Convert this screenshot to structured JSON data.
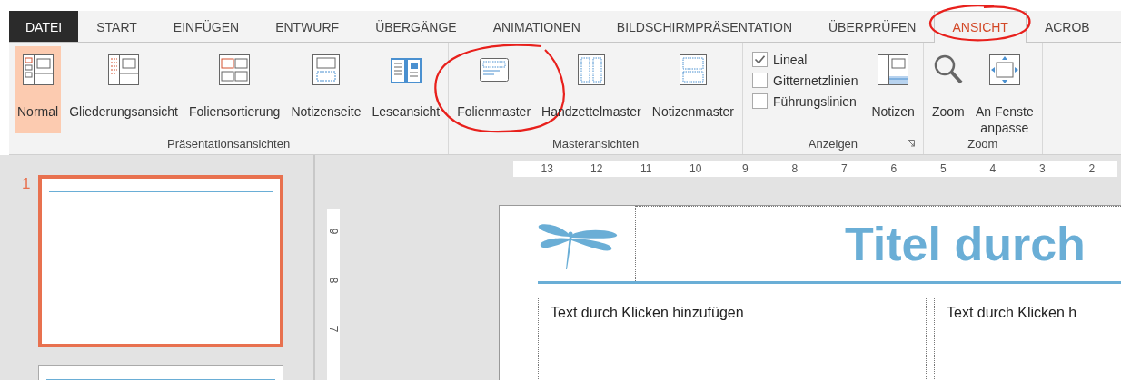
{
  "tabs": [
    {
      "label": "DATEI",
      "kind": "file",
      "selected": false,
      "circled": false
    },
    {
      "label": "START",
      "kind": "tab",
      "selected": false,
      "circled": false
    },
    {
      "label": "EINFÜGEN",
      "kind": "tab",
      "selected": false,
      "circled": false
    },
    {
      "label": "ENTWURF",
      "kind": "tab",
      "selected": false,
      "circled": false
    },
    {
      "label": "ÜBERGÄNGE",
      "kind": "tab",
      "selected": false,
      "circled": false
    },
    {
      "label": "ANIMATIONEN",
      "kind": "tab",
      "selected": false,
      "circled": false
    },
    {
      "label": "BILDSCHIRMPRÄSENTATION",
      "kind": "tab",
      "selected": false,
      "circled": false
    },
    {
      "label": "ÜBERPRÜFEN",
      "kind": "tab",
      "selected": false,
      "circled": false
    },
    {
      "label": "ANSICHT",
      "kind": "tab",
      "selected": true,
      "circled": true
    },
    {
      "label": "ACROB",
      "kind": "tab",
      "selected": false,
      "circled": false
    }
  ],
  "ribbon": {
    "groups": [
      {
        "label": "Präsentationsansichten",
        "launcher": false,
        "items": [
          {
            "kind": "large",
            "label": "Normal",
            "selected": true,
            "circled": false
          },
          {
            "kind": "large",
            "label": "Gliederungsansicht",
            "selected": false,
            "circled": false
          },
          {
            "kind": "large",
            "label": "Foliensortierung",
            "selected": false,
            "circled": false
          },
          {
            "kind": "large",
            "label": "Notizenseite",
            "selected": false,
            "circled": false
          },
          {
            "kind": "large",
            "label": "Leseansicht",
            "selected": false,
            "circled": false
          }
        ]
      },
      {
        "label": "Masteransichten",
        "launcher": false,
        "items": [
          {
            "kind": "large",
            "label": "Folienmaster",
            "selected": false,
            "circled": true
          },
          {
            "kind": "large",
            "label": "Handzettelmaster",
            "selected": false,
            "circled": false
          },
          {
            "kind": "large",
            "label": "Notizenmaster",
            "selected": false,
            "circled": false
          }
        ]
      },
      {
        "label": "Anzeigen",
        "launcher": true,
        "items": [
          {
            "kind": "check",
            "label": "Lineal",
            "checked": true
          },
          {
            "kind": "check",
            "label": "Gitternetzlinien",
            "checked": false
          },
          {
            "kind": "check",
            "label": "Führungslinien",
            "checked": false
          },
          {
            "kind": "large",
            "label": "Notizen",
            "selected": false,
            "circled": false
          }
        ]
      },
      {
        "label": "Zoom",
        "launcher": false,
        "items": [
          {
            "kind": "large",
            "label": "Zoom",
            "selected": false,
            "circled": false
          },
          {
            "kind": "large",
            "label": "An Fenste",
            "label_2": "anpasse",
            "selected": false,
            "circled": false
          }
        ]
      }
    ]
  },
  "thumbnails": [
    {
      "number": "1",
      "selected": true
    },
    {
      "selected": false
    }
  ],
  "ruler": {
    "horizontal": [
      "13",
      "12",
      "11",
      "10",
      "9",
      "8",
      "7",
      "6",
      "5",
      "4",
      "3",
      "2"
    ],
    "vertical": [
      "9",
      "8",
      "7"
    ]
  },
  "slide": {
    "title": "Titel durch",
    "content": [
      "Text durch Klicken hinzufügen",
      "Text durch Klicken h"
    ]
  }
}
